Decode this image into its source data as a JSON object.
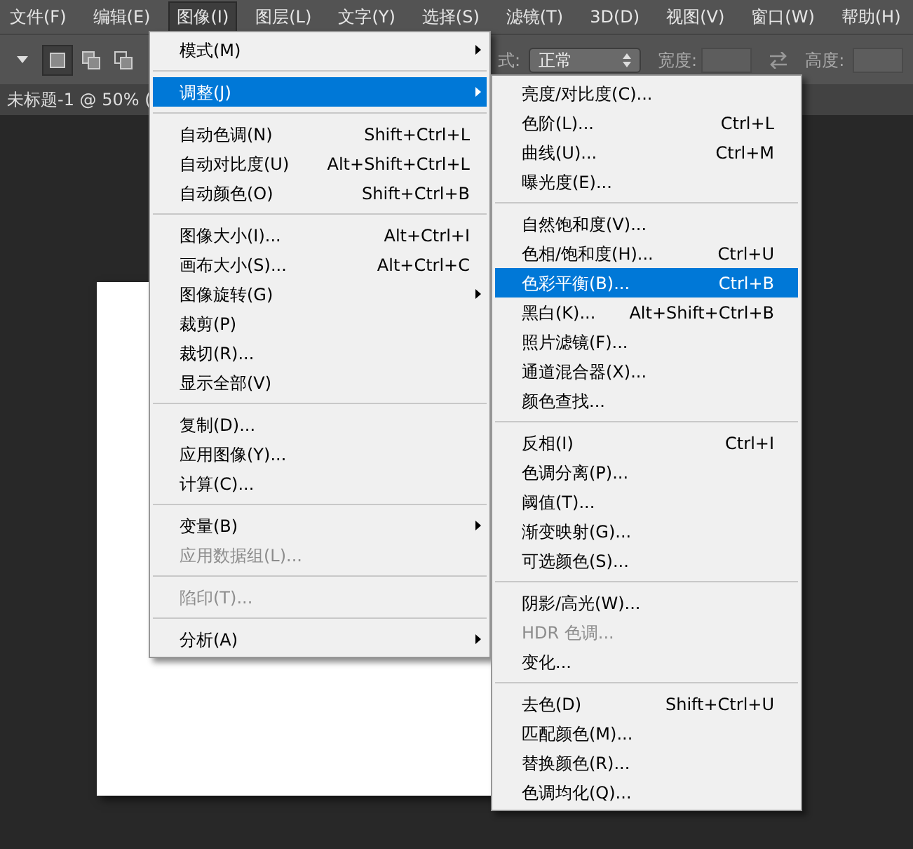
{
  "menubar": [
    {
      "label": "文件(F)",
      "selected": false
    },
    {
      "label": "编辑(E)",
      "selected": false
    },
    {
      "label": "图像(I)",
      "selected": true
    },
    {
      "label": "图层(L)",
      "selected": false
    },
    {
      "label": "文字(Y)",
      "selected": false
    },
    {
      "label": "选择(S)",
      "selected": false
    },
    {
      "label": "滤镜(T)",
      "selected": false
    },
    {
      "label": "3D(D)",
      "selected": false
    },
    {
      "label": "视图(V)",
      "selected": false
    },
    {
      "label": "窗口(W)",
      "selected": false
    },
    {
      "label": "帮助(H)",
      "selected": false
    }
  ],
  "options_bar": {
    "style_label": "式:",
    "style_value": "正常",
    "width_label": "宽度:",
    "height_label": "高度:"
  },
  "document_tab": {
    "title": "未标题-1 @ 50% ("
  },
  "image_menu": [
    {
      "kind": "item",
      "label": "模式(M)",
      "submenu": true,
      "selected": false,
      "disabled": false
    },
    {
      "kind": "separator"
    },
    {
      "kind": "item",
      "label": "调整(J)",
      "submenu": true,
      "selected": true,
      "disabled": false
    },
    {
      "kind": "separator"
    },
    {
      "kind": "item",
      "label": "自动色调(N)",
      "shortcut": "Shift+Ctrl+L",
      "selected": false,
      "disabled": false
    },
    {
      "kind": "item",
      "label": "自动对比度(U)",
      "shortcut": "Alt+Shift+Ctrl+L",
      "selected": false,
      "disabled": false
    },
    {
      "kind": "item",
      "label": "自动颜色(O)",
      "shortcut": "Shift+Ctrl+B",
      "selected": false,
      "disabled": false
    },
    {
      "kind": "separator"
    },
    {
      "kind": "item",
      "label": "图像大小(I)...",
      "shortcut": "Alt+Ctrl+I",
      "selected": false,
      "disabled": false
    },
    {
      "kind": "item",
      "label": "画布大小(S)...",
      "shortcut": "Alt+Ctrl+C",
      "selected": false,
      "disabled": false
    },
    {
      "kind": "item",
      "label": "图像旋转(G)",
      "submenu": true,
      "selected": false,
      "disabled": false
    },
    {
      "kind": "item",
      "label": "裁剪(P)",
      "selected": false,
      "disabled": false
    },
    {
      "kind": "item",
      "label": "裁切(R)...",
      "selected": false,
      "disabled": false
    },
    {
      "kind": "item",
      "label": "显示全部(V)",
      "selected": false,
      "disabled": false
    },
    {
      "kind": "separator"
    },
    {
      "kind": "item",
      "label": "复制(D)...",
      "selected": false,
      "disabled": false
    },
    {
      "kind": "item",
      "label": "应用图像(Y)...",
      "selected": false,
      "disabled": false
    },
    {
      "kind": "item",
      "label": "计算(C)...",
      "selected": false,
      "disabled": false
    },
    {
      "kind": "separator"
    },
    {
      "kind": "item",
      "label": "变量(B)",
      "submenu": true,
      "selected": false,
      "disabled": false
    },
    {
      "kind": "item",
      "label": "应用数据组(L)...",
      "selected": false,
      "disabled": true
    },
    {
      "kind": "separator"
    },
    {
      "kind": "item",
      "label": "陷印(T)...",
      "selected": false,
      "disabled": true
    },
    {
      "kind": "separator"
    },
    {
      "kind": "item",
      "label": "分析(A)",
      "submenu": true,
      "selected": false,
      "disabled": false
    }
  ],
  "adjust_menu": [
    {
      "kind": "item",
      "label": "亮度/对比度(C)...",
      "selected": false,
      "disabled": false
    },
    {
      "kind": "item",
      "label": "色阶(L)...",
      "shortcut": "Ctrl+L",
      "selected": false,
      "disabled": false
    },
    {
      "kind": "item",
      "label": "曲线(U)...",
      "shortcut": "Ctrl+M",
      "selected": false,
      "disabled": false
    },
    {
      "kind": "item",
      "label": "曝光度(E)...",
      "selected": false,
      "disabled": false
    },
    {
      "kind": "separator"
    },
    {
      "kind": "item",
      "label": "自然饱和度(V)...",
      "selected": false,
      "disabled": false
    },
    {
      "kind": "item",
      "label": "色相/饱和度(H)...",
      "shortcut": "Ctrl+U",
      "selected": false,
      "disabled": false
    },
    {
      "kind": "item",
      "label": "色彩平衡(B)...",
      "shortcut": "Ctrl+B",
      "selected": true,
      "disabled": false
    },
    {
      "kind": "item",
      "label": "黑白(K)...",
      "shortcut": "Alt+Shift+Ctrl+B",
      "selected": false,
      "disabled": false
    },
    {
      "kind": "item",
      "label": "照片滤镜(F)...",
      "selected": false,
      "disabled": false
    },
    {
      "kind": "item",
      "label": "通道混合器(X)...",
      "selected": false,
      "disabled": false
    },
    {
      "kind": "item",
      "label": "颜色查找...",
      "selected": false,
      "disabled": false
    },
    {
      "kind": "separator"
    },
    {
      "kind": "item",
      "label": "反相(I)",
      "shortcut": "Ctrl+I",
      "selected": false,
      "disabled": false
    },
    {
      "kind": "item",
      "label": "色调分离(P)...",
      "selected": false,
      "disabled": false
    },
    {
      "kind": "item",
      "label": "阈值(T)...",
      "selected": false,
      "disabled": false
    },
    {
      "kind": "item",
      "label": "渐变映射(G)...",
      "selected": false,
      "disabled": false
    },
    {
      "kind": "item",
      "label": "可选颜色(S)...",
      "selected": false,
      "disabled": false
    },
    {
      "kind": "separator"
    },
    {
      "kind": "item",
      "label": "阴影/高光(W)...",
      "selected": false,
      "disabled": false
    },
    {
      "kind": "item",
      "label": "HDR 色调...",
      "selected": false,
      "disabled": true
    },
    {
      "kind": "item",
      "label": "变化...",
      "selected": false,
      "disabled": false
    },
    {
      "kind": "separator"
    },
    {
      "kind": "item",
      "label": "去色(D)",
      "shortcut": "Shift+Ctrl+U",
      "selected": false,
      "disabled": false
    },
    {
      "kind": "item",
      "label": "匹配颜色(M)...",
      "selected": false,
      "disabled": false
    },
    {
      "kind": "item",
      "label": "替换颜色(R)...",
      "selected": false,
      "disabled": false
    },
    {
      "kind": "item",
      "label": "色调均化(Q)...",
      "selected": false,
      "disabled": false
    }
  ]
}
